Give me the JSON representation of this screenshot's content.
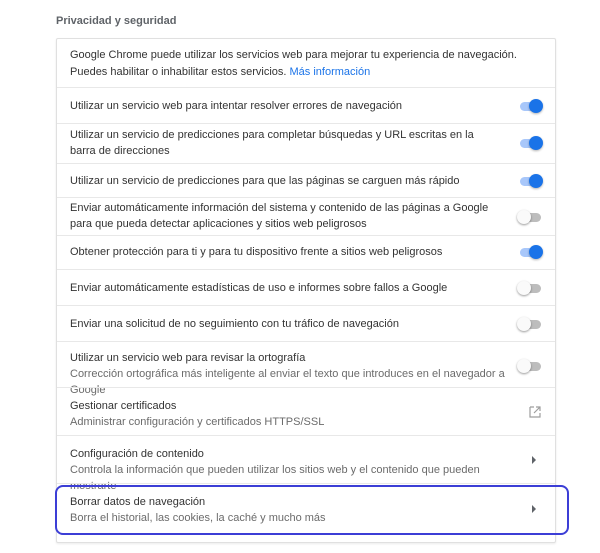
{
  "section": {
    "title": "Privacidad y seguridad"
  },
  "intro": {
    "text": "Google Chrome puede utilizar los servicios web para mejorar tu experiencia de navegación. Puedes habilitar o inhabilitar estos servicios.",
    "link": "Más información"
  },
  "rows": [
    {
      "label": "Utilizar un servicio web para intentar resolver errores de navegación",
      "toggle": "on"
    },
    {
      "label": "Utilizar un servicio de predicciones para completar búsquedas y URL escritas en la barra de direcciones",
      "toggle": "on"
    },
    {
      "label": "Utilizar un servicio de predicciones para que las páginas se carguen más rápido",
      "toggle": "on"
    },
    {
      "label": "Enviar automáticamente información del sistema y contenido de las páginas a Google para que pueda detectar aplicaciones y sitios web peligrosos",
      "toggle": "off"
    },
    {
      "label": "Obtener protección para ti y para tu dispositivo frente a sitios web peligrosos",
      "toggle": "on"
    },
    {
      "label": "Enviar automáticamente estadísticas de uso e informes sobre fallos a Google",
      "toggle": "off"
    },
    {
      "label": "Enviar una solicitud de no seguimiento con tu tráfico de navegación",
      "toggle": "off"
    },
    {
      "label": "Utilizar un servicio web para revisar la ortografía",
      "sublabel": "Corrección ortográfica más inteligente al enviar el texto que introduces en el navegador a Google",
      "toggle": "off"
    },
    {
      "label": "Gestionar certificados",
      "sublabel": "Administrar configuración y certificados HTTPS/SSL",
      "icon": "open-in-new-icon"
    },
    {
      "label": "Configuración de contenido",
      "sublabel": "Controla la información que pueden utilizar los sitios web y el contenido que pueden mostrarte",
      "icon": "chevron-right-icon"
    },
    {
      "label": "Borrar datos de navegación",
      "sublabel": "Borra el historial, las cookies, la caché y mucho más",
      "icon": "chevron-right-icon"
    }
  ],
  "colors": {
    "accent": "#1a73e8",
    "highlight": "#3c3ed6"
  }
}
